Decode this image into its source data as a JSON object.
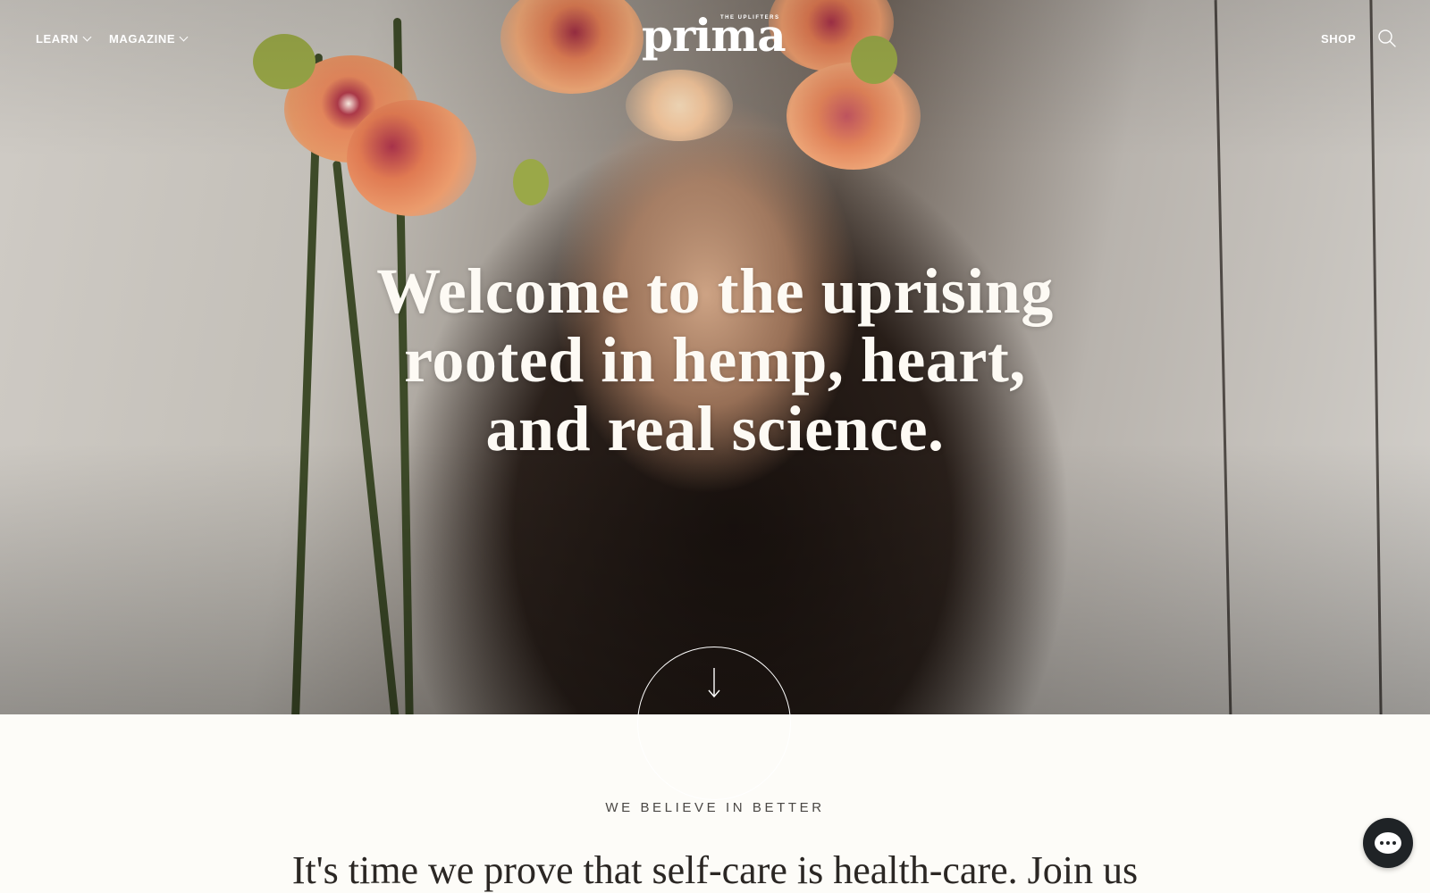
{
  "header": {
    "nav_left": [
      {
        "label": "LEARN",
        "icon": "chevron-down-icon"
      },
      {
        "label": "MAGAZINE",
        "icon": "chevron-down-icon"
      }
    ],
    "logo": {
      "kicker": "THE UPLIFTERS",
      "text": "prima"
    },
    "nav_right": {
      "shop_label": "SHOP",
      "search_icon": "search-icon"
    }
  },
  "hero": {
    "headline_lines": [
      "Welcome to the uprising",
      "rooted in hemp, heart,",
      "and real science."
    ],
    "scroll_icon": "arrow-down-icon",
    "image_subject": "woman with orange orchids"
  },
  "section": {
    "eyebrow": "WE BELIEVE IN BETTER",
    "intro": "It's time we prove that self-care is health-care. Join us"
  },
  "chat": {
    "icon": "chat-bubble-icon"
  },
  "colors": {
    "page_bg": "#fdfcf8",
    "text_dark": "#2b2724",
    "chat_bg": "#1f2326",
    "orchid": "#e8895e"
  }
}
